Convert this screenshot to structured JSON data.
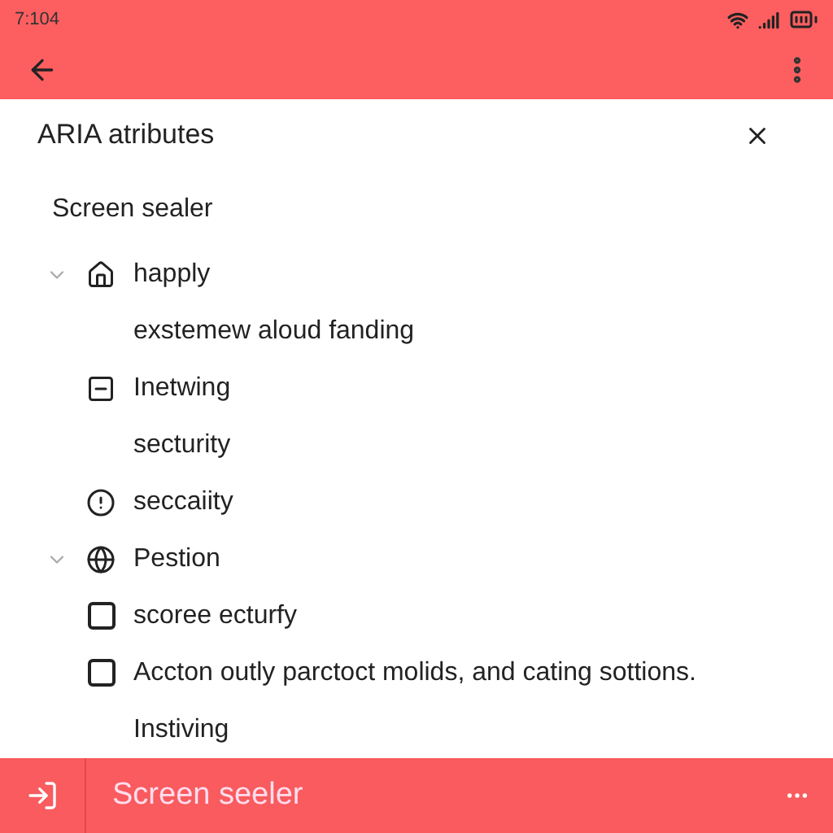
{
  "status_bar": {
    "time": "7:104"
  },
  "panel": {
    "title": "ARIA atributes",
    "subtitle": "Screen sealer"
  },
  "items": [
    {
      "kind": "group",
      "expanded": true,
      "label": "happly"
    },
    {
      "kind": "text",
      "label": "exstemew aloud fanding"
    },
    {
      "kind": "icon",
      "label": "Inetwing"
    },
    {
      "kind": "text",
      "label": "secturity"
    },
    {
      "kind": "icon",
      "label": "seccaiity"
    },
    {
      "kind": "group",
      "expanded": true,
      "label": "Pestion"
    },
    {
      "kind": "checkbox",
      "checked": false,
      "label": "scoree ecturfy"
    },
    {
      "kind": "checkbox",
      "checked": false,
      "label": "Accton outly parctoct molids, and cating sottions."
    },
    {
      "kind": "text",
      "label": "Instiving"
    }
  ],
  "bottom_bar": {
    "title": "Screen seeler"
  }
}
